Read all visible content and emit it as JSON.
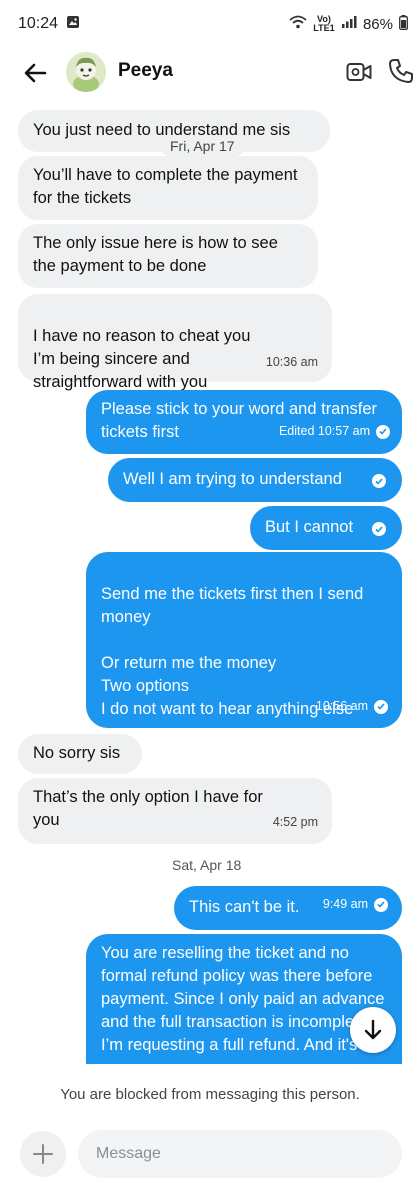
{
  "status_bar": {
    "time": "10:24",
    "network": "Vo) LTE1",
    "battery": "86%"
  },
  "header": {
    "contact_name": "Peeya"
  },
  "messages": [
    {
      "text": "You just need to understand me sis",
      "direction": "in"
    },
    {
      "text": "You’ll have to complete the payment for the tickets",
      "direction": "in"
    },
    {
      "text": "The only issue here is how to see the payment to be done",
      "direction": "in"
    },
    {
      "text": "I have no reason to cheat you\nI’m being sincere and straightforward with you",
      "direction": "in",
      "time": "10:36 am"
    },
    {
      "text": "Please stick to your word and transfer tickets first",
      "direction": "out",
      "time": "Edited 10:57 am"
    },
    {
      "text": "Well I am trying to understand",
      "direction": "out"
    },
    {
      "text": "But I cannot",
      "direction": "out"
    },
    {
      "text": "Send me the tickets first then I send money\n\nOr return me the money\nTwo options\nI do not want to hear anything else",
      "direction": "out",
      "time": "10:56 am"
    },
    {
      "text": "No sorry sis",
      "direction": "in"
    },
    {
      "text": "That’s the only option I have for you",
      "direction": "in",
      "time": "4:52 pm"
    },
    {
      "text": "This can't be it.",
      "direction": "out",
      "time": "9:49 am"
    },
    {
      "text": "You are reselling the ticket and no formal refund policy was there before payment. Since I only paid an advance and the full transaction is incomplete, I’m requesting a full refund. And it's",
      "direction": "out"
    }
  ],
  "date_separators": {
    "sticky": "Fri, Apr 17",
    "sat": "Sat, Apr 18"
  },
  "composer": {
    "blocked_note": "You are blocked from messaging this person.",
    "placeholder": "Message"
  },
  "colors": {
    "outgoing_bubble": "#1d96ef",
    "incoming_bubble": "#eef0f2"
  },
  "icons": [
    "back-arrow-icon",
    "video-call-icon",
    "phone-icon",
    "check-icon",
    "arrow-down-icon",
    "plus-icon"
  ]
}
